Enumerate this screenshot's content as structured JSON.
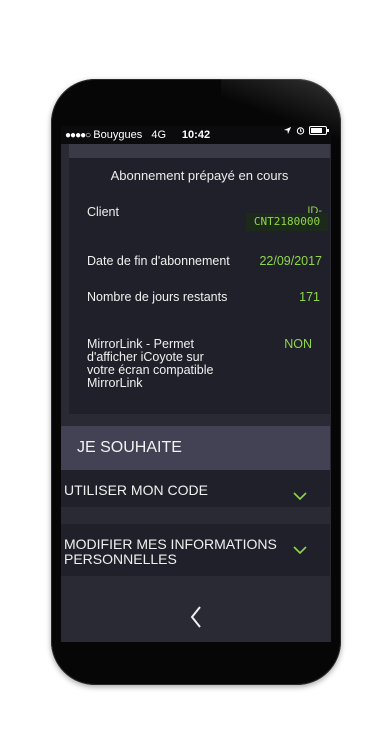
{
  "status": {
    "signal": "●●●●○",
    "carrier": "Bouygues",
    "network": "4G",
    "time": "10:42"
  },
  "card": {
    "title": "Abonnement prépayé en cours",
    "rows": [
      {
        "label": "Client",
        "value_prefix": "ID-",
        "value": "CNT2180000"
      },
      {
        "label": "Date de fin d'abonnement",
        "value": "22/09/2017"
      },
      {
        "label": "Nombre de jours restants",
        "value": "171"
      },
      {
        "label": "MirrorLink - Permet\nd'afficher iCoyote sur\nvotre écran compatible\nMirrorLink",
        "value": "NON"
      }
    ]
  },
  "wish": {
    "header": "JE SOUHAITE",
    "options": [
      {
        "label": "UTILISER MON CODE"
      },
      {
        "label": "MODIFIER MES INFORMATIONS\nPERSONNELLES"
      }
    ]
  },
  "colors": {
    "accent": "#8fd64a",
    "background": "#2a2a34",
    "card": "#20202a",
    "header": "#424254"
  },
  "icons": [
    "location-arrow-icon",
    "alarm-icon",
    "battery-icon",
    "chevron-down-icon",
    "back-chevron-icon"
  ]
}
